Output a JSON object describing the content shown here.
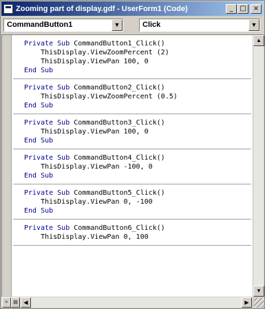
{
  "window": {
    "title": "Zooming part of display.gdf - UserForm1 (Code)",
    "minimize_glyph": "_",
    "maximize_glyph": "□",
    "close_glyph": "×"
  },
  "object_combo": {
    "value": "CommandButton1"
  },
  "procedure_combo": {
    "value": "Click"
  },
  "code": {
    "procedures": [
      {
        "lines": [
          {
            "kw": "Private Sub",
            "rest": " CommandButton1_Click()"
          },
          {
            "kw": "",
            "rest": "    ThisDisplay.ViewZoomPercent (2)"
          },
          {
            "kw": "",
            "rest": "    ThisDisplay.ViewPan 100, 0"
          },
          {
            "kw": "End Sub",
            "rest": ""
          }
        ]
      },
      {
        "lines": [
          {
            "kw": "Private Sub",
            "rest": " CommandButton2_Click()"
          },
          {
            "kw": "",
            "rest": "    ThisDisplay.ViewZoomPercent (0.5)"
          },
          {
            "kw": "End Sub",
            "rest": ""
          }
        ]
      },
      {
        "lines": [
          {
            "kw": "Private Sub",
            "rest": " CommandButton3_Click()"
          },
          {
            "kw": "",
            "rest": "    ThisDisplay.ViewPan 100, 0"
          },
          {
            "kw": "End Sub",
            "rest": ""
          }
        ]
      },
      {
        "lines": [
          {
            "kw": "Private Sub",
            "rest": " CommandButton4_Click()"
          },
          {
            "kw": "",
            "rest": "    ThisDisplay.ViewPan -100, 0"
          },
          {
            "kw": "End Sub",
            "rest": ""
          }
        ]
      },
      {
        "lines": [
          {
            "kw": "Private Sub",
            "rest": " CommandButton5_Click()"
          },
          {
            "kw": "",
            "rest": "    ThisDisplay.ViewPan 0, -100"
          },
          {
            "kw": "End Sub",
            "rest": ""
          }
        ]
      },
      {
        "lines": [
          {
            "kw": "Private Sub",
            "rest": " CommandButton6_Click()"
          },
          {
            "kw": "",
            "rest": "    ThisDisplay.ViewPan 0, 100"
          }
        ]
      }
    ]
  },
  "icons": {
    "combo_arrow": "▼",
    "scroll_up": "▲",
    "scroll_down": "▼",
    "scroll_left": "◀",
    "scroll_right": "▶"
  },
  "colors": {
    "keyword": "#00008b",
    "title_bar": "#0a246a"
  }
}
